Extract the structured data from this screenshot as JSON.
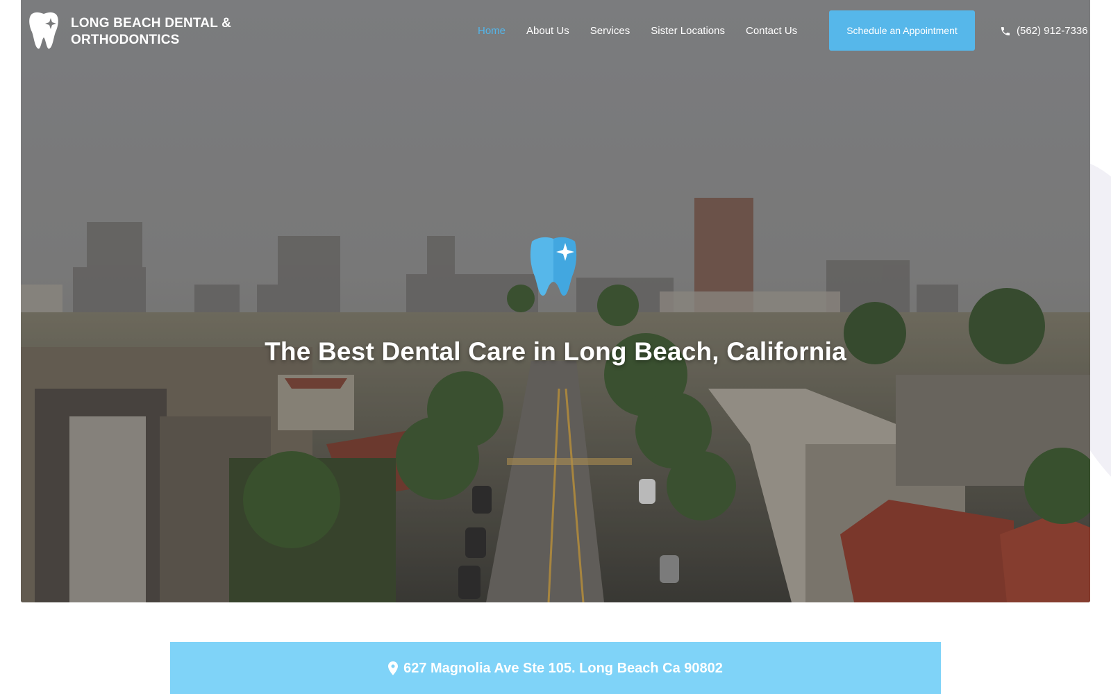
{
  "brand": {
    "name_line1": "LONG BEACH DENTAL &",
    "name_line2": "ORTHODONTICS",
    "logo_icon": "tooth-sparkle-icon"
  },
  "nav": {
    "items": [
      {
        "label": "Home",
        "active": true
      },
      {
        "label": "About Us",
        "active": false
      },
      {
        "label": "Services",
        "active": false
      },
      {
        "label": "Sister Locations",
        "active": false
      },
      {
        "label": "Contact Us",
        "active": false
      }
    ]
  },
  "cta": {
    "label": "Schedule an Appointment"
  },
  "contact": {
    "phone": "(562) 912-7336",
    "phone_icon": "phone-icon"
  },
  "hero": {
    "badge_icon": "tooth-shield-icon",
    "title": "The Best Dental Care in Long Beach, California",
    "background": "aerial-city-street-photo"
  },
  "address": {
    "icon": "map-pin-icon",
    "text": "627 Magnolia Ave Ste 105. Long Beach Ca 90802"
  },
  "colors": {
    "accent": "#56b7ea",
    "nav_active": "#53b6ea",
    "address_bar": "#7fd3f8",
    "text_light": "#ffffff"
  }
}
